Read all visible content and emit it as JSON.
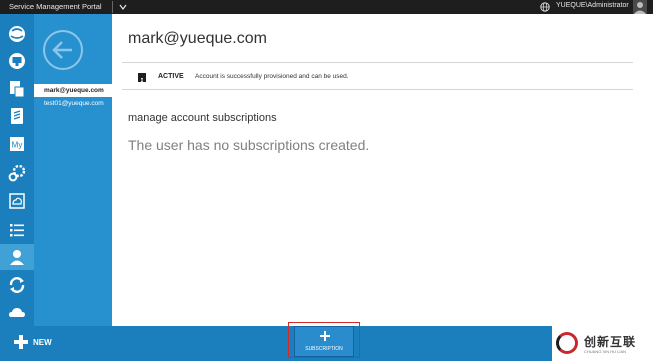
{
  "topbar": {
    "title": "Service Management Portal",
    "user": "YUEQUE\\Administrator"
  },
  "rail": {
    "items": [
      {
        "icon": "globe-icon"
      },
      {
        "icon": "monitor-icon"
      },
      {
        "icon": "database-icon"
      },
      {
        "icon": "sql-server-icon"
      },
      {
        "icon": "mysql-icon",
        "text": "My"
      },
      {
        "icon": "automation-icon"
      },
      {
        "icon": "cloud-service-icon"
      },
      {
        "icon": "list-icon"
      },
      {
        "icon": "user-accounts-icon"
      },
      {
        "icon": "sync-icon"
      },
      {
        "icon": "cloud-icon"
      }
    ],
    "active_index": 8
  },
  "accounts": {
    "items": [
      {
        "label": "mark@yueque.com",
        "selected": true
      },
      {
        "label": "test01@yueque.com",
        "selected": false
      }
    ]
  },
  "main": {
    "title": "mark@yueque.com",
    "status": {
      "label": "ACTIVE",
      "message": "Account is successfully provisioned and can be used."
    },
    "section_heading": "manage account subscriptions",
    "empty_message": "The user has no subscriptions created."
  },
  "command_bar": {
    "new_label": "NEW",
    "subscription_label": "SUBSCRIPTION"
  },
  "watermark": {
    "text": "创新互联",
    "subtext": "CHUANG XIN HU LIAN"
  },
  "colors": {
    "rail": "#1a7fbc",
    "panel": "#2791cf",
    "topbar": "#1e1e1e",
    "highlight": "#d62a2a"
  }
}
